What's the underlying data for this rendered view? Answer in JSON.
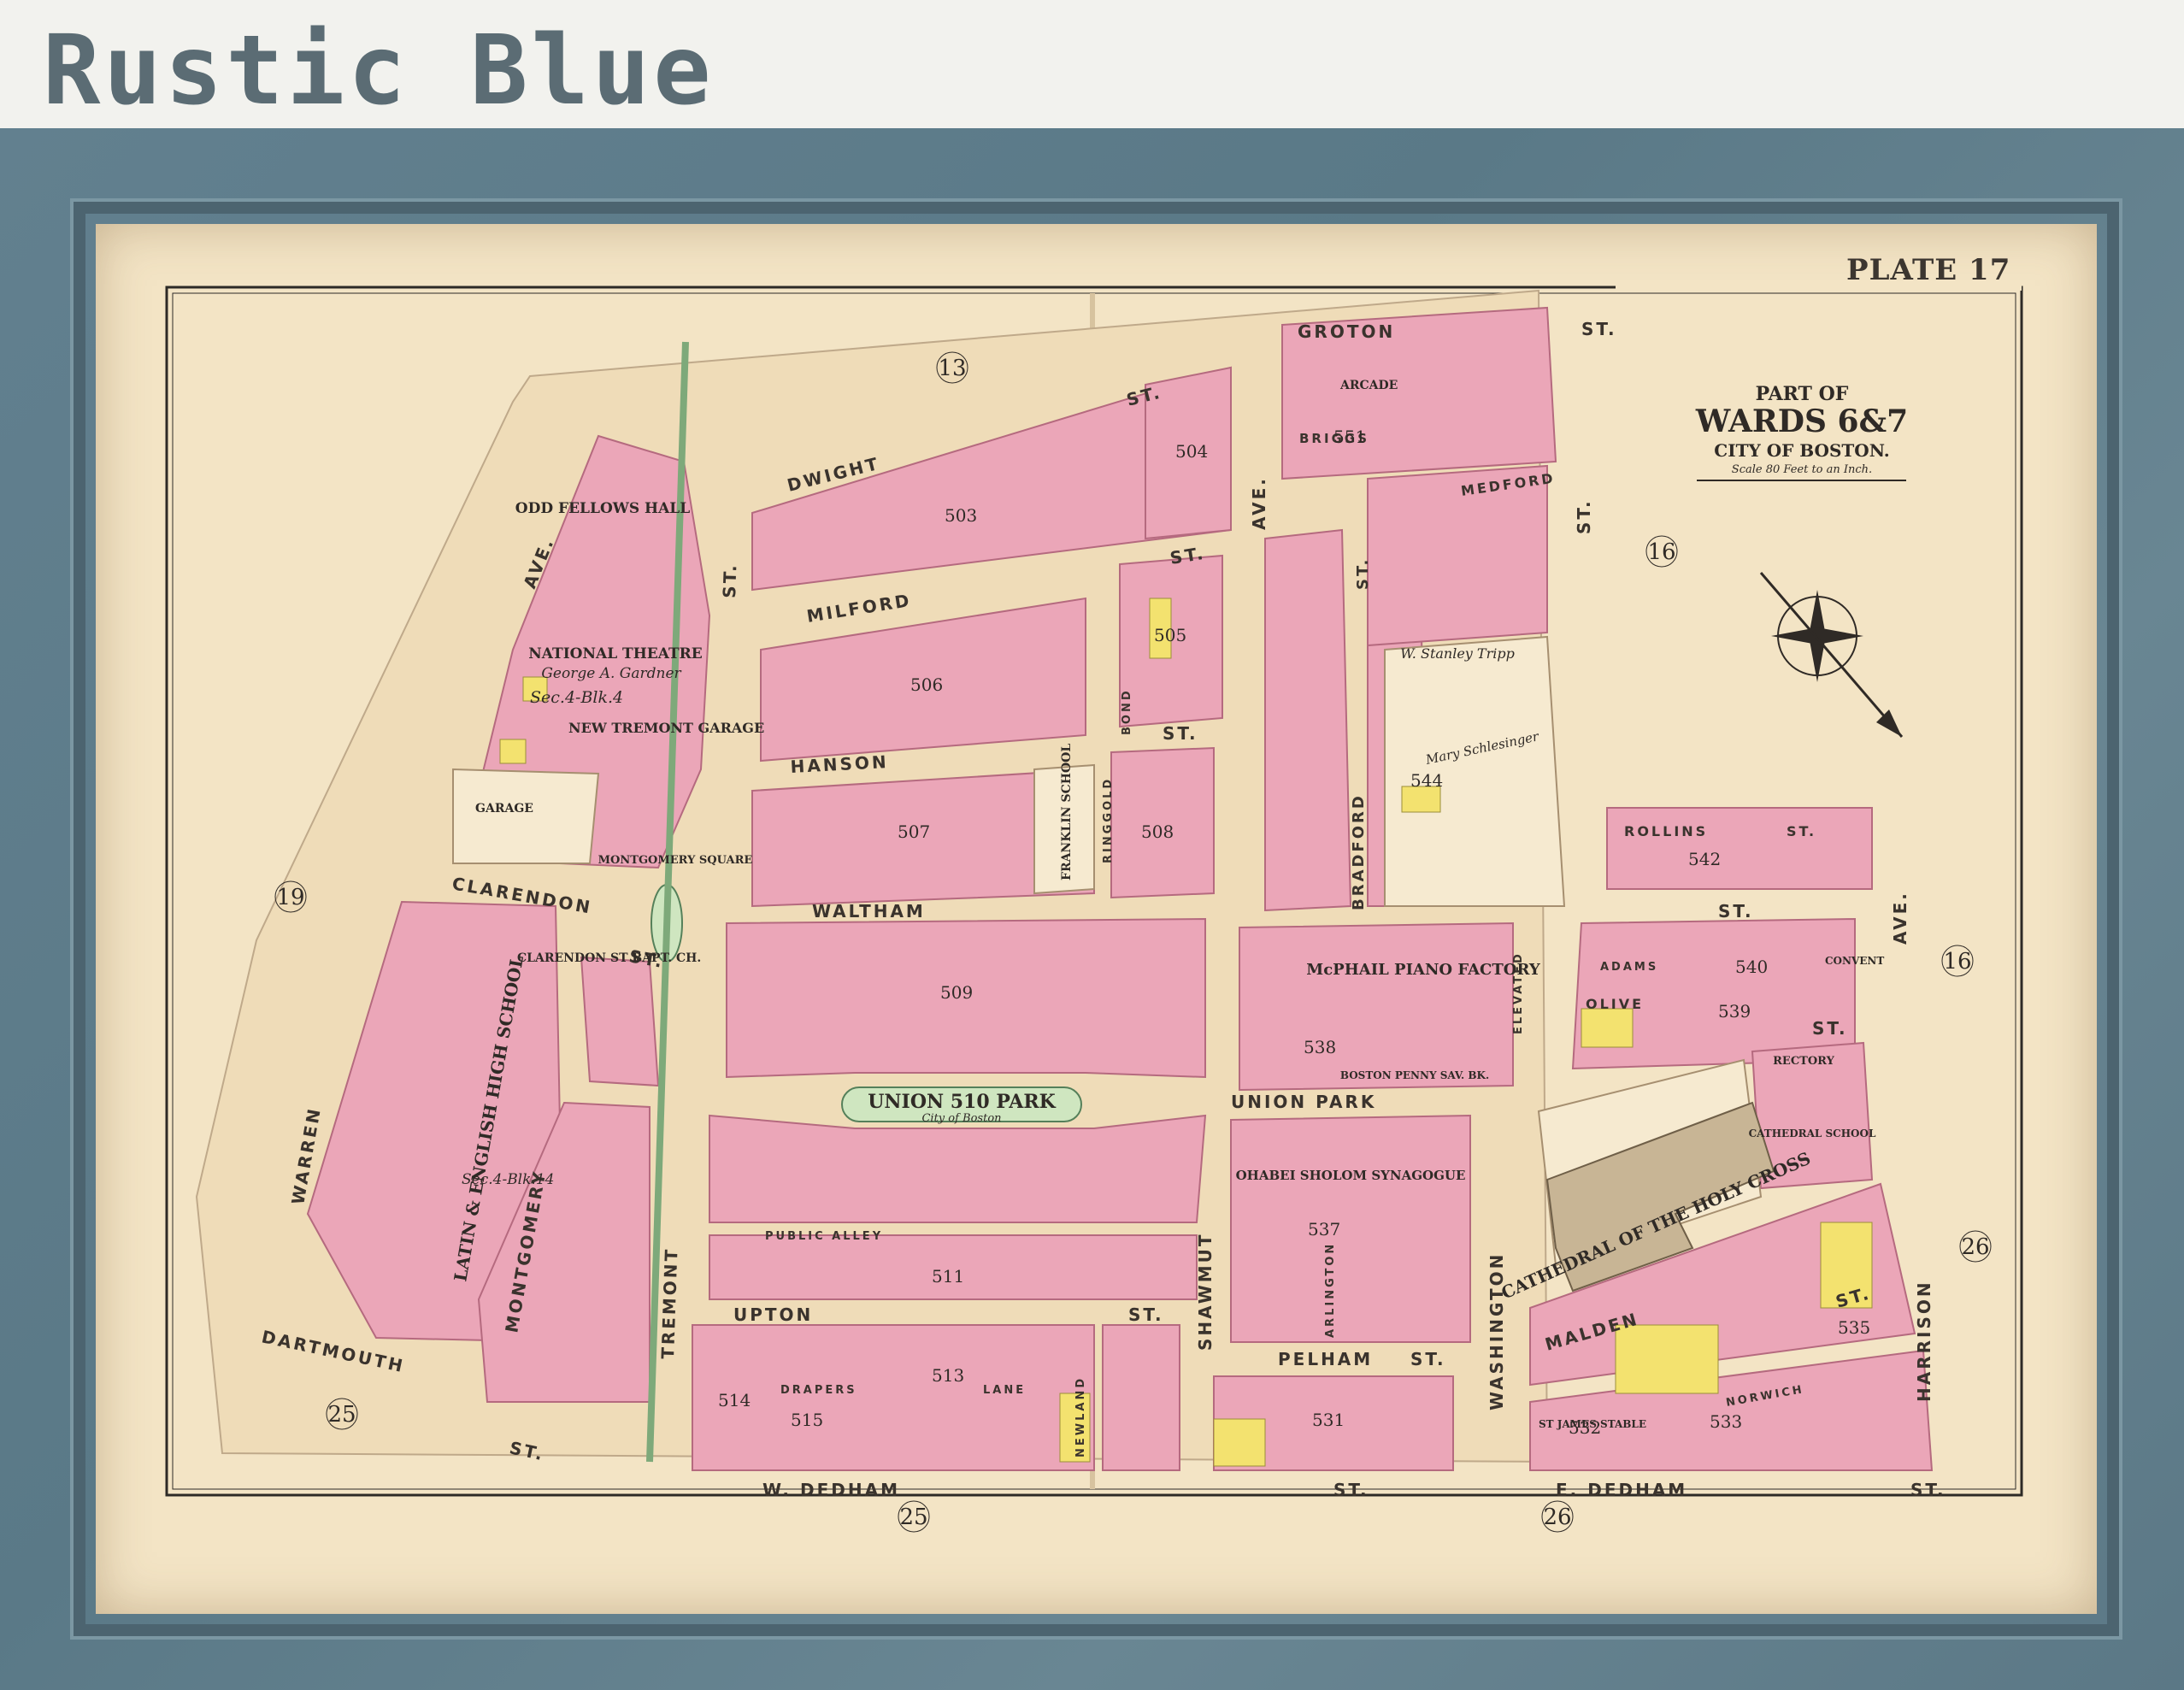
{
  "header": {
    "title": "Rustic Blue"
  },
  "plate": {
    "label": "PLATE 17"
  },
  "cartouche": {
    "line1": "PART OF",
    "line2": "WARDS 6&7",
    "line3": "CITY OF BOSTON.",
    "scale": "Scale 80 Feet to an Inch."
  },
  "wards": [
    "13",
    "16",
    "16",
    "19",
    "25",
    "25",
    "26",
    "26"
  ],
  "streets": {
    "groton": "GROTON",
    "dwight": "DWIGHT",
    "milford": "MILFORD",
    "hanson": "HANSON",
    "waltham": "WALTHAM",
    "clarendon": "CLARENDON",
    "union_park": "UNION PARK",
    "upton": "UPTON",
    "w_dedham": "W. DEDHAM",
    "e_dedham": "E. DEDHAM",
    "dartmouth": "DARTMOUTH",
    "warren": "WARREN",
    "montgomery": "MONTGOMERY",
    "tremont": "TREMONT",
    "shawmut": "SHAWMUT",
    "washington": "WASHINGTON",
    "harrison": "HARRISON",
    "malden": "MALDEN",
    "rollins": "ROLLINS",
    "pelham": "PELHAM",
    "medford": "MEDFORD",
    "briggs": "BRIGGS",
    "bradford": "BRADFORD",
    "olive": "OLIVE",
    "adams": "ADAMS",
    "bond": "BOND",
    "ringgold": "RINGGOLD",
    "norwich": "NORWICH",
    "newland": "NEWLAND",
    "arlington": "ARLINGTON",
    "st": "ST.",
    "ave": "AVE.",
    "public_alley": "PUBLIC ALLEY",
    "drapers": "DRAPERS",
    "lane": "LANE",
    "elevated": "ELEVATED"
  },
  "landmarks": {
    "odd_fellows": "ODD FELLOWS HALL",
    "national_theatre": "NATIONAL THEATRE",
    "new_tremont_garage": "NEW TREMONT GARAGE",
    "garage": "GARAGE",
    "montgomery_square": "MONTGOMERY SQUARE",
    "clarendon_bapt": "CLARENDON ST BAPT. CH.",
    "high_school": "LATIN & ENGLISH HIGH SCHOOL",
    "franklin_school": "FRANKLIN SCHOOL",
    "union_park": "UNION 510 PARK",
    "city_of_boston": "City of Boston",
    "piano_factory": "McPHAIL PIANO FACTORY",
    "synagogue": "OHABEI SHOLOM SYNAGOGUE",
    "cathedral": "CATHEDRAL OF THE HOLY CROSS",
    "cathedral_school": "CATHEDRAL SCHOOL",
    "rectory": "RECTORY",
    "convent": "CONVENT",
    "boston_bank": "BOSTON PENNY SAV. BK.",
    "arcade": "ARCADE",
    "st_james_stable": "ST JAMES STABLE"
  },
  "owners": {
    "gardner": "George A. Gardner",
    "tripp": "W. Stanley Tripp",
    "schlesinger": "Mary Schlesinger",
    "sec4": "Sec.4-Blk.4",
    "sec14": "Sec.4-Blk.14"
  },
  "blocks": [
    "503",
    "504",
    "505",
    "506",
    "507",
    "508",
    "509",
    "511",
    "513",
    "514",
    "515",
    "531",
    "532",
    "533",
    "535",
    "537",
    "538",
    "539",
    "540",
    "542",
    "544",
    "551"
  ]
}
